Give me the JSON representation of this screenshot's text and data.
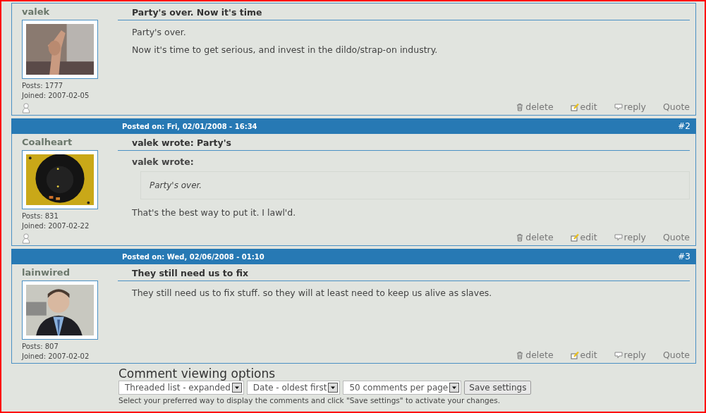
{
  "comments": [
    {
      "author": "valek",
      "avatar": {
        "kind": "picture"
      },
      "posts": "Posts: 1777",
      "joined": "Joined: 2007-02-05",
      "status_icon": true,
      "subject": "Party's over. Now it's time",
      "body": [
        "Party's over.",
        "Now it's time to get serious, and invest in the dildo/strap-on industry."
      ],
      "links": [
        {
          "kind": "delete",
          "label": "delete"
        },
        {
          "kind": "edit",
          "label": "edit"
        },
        {
          "kind": "reply",
          "label": "reply"
        },
        {
          "kind": "quote",
          "label": "Quote"
        }
      ]
    },
    {
      "header": {
        "posted": "Posted on: Fri, 02/01/2008 - 16:34",
        "number": "#2"
      },
      "author": "Coalheart",
      "avatar": {
        "kind": "picture"
      },
      "posts": "Posts: 831",
      "joined": "Joined: 2007-02-22",
      "status_icon": true,
      "subject": "valek wrote: Party's",
      "quote": {
        "label": "valek wrote:",
        "text": "Party's over."
      },
      "body": [
        "That's the best way to put it. I lawl'd."
      ],
      "links": [
        {
          "kind": "delete",
          "label": "delete"
        },
        {
          "kind": "edit",
          "label": "edit"
        },
        {
          "kind": "reply",
          "label": "reply"
        },
        {
          "kind": "quote",
          "label": "Quote"
        }
      ]
    },
    {
      "header": {
        "posted": "Posted on: Wed, 02/06/2008 - 01:10",
        "number": "#3"
      },
      "author": "lainwired",
      "avatar": {
        "kind": "picture"
      },
      "posts": "Posts: 807",
      "joined": "Joined: 2007-02-02",
      "status_icon": false,
      "subject": "They still need us to fix",
      "body": [
        "They still need us to fix stuff. so they will at least need to keep us alive as slaves."
      ],
      "links": [
        {
          "kind": "delete",
          "label": "delete"
        },
        {
          "kind": "edit",
          "label": "edit"
        },
        {
          "kind": "reply",
          "label": "reply"
        },
        {
          "kind": "quote",
          "label": "Quote"
        }
      ]
    }
  ],
  "viewing_options": {
    "title": "Comment viewing options",
    "selects": [
      "Threaded list - expanded",
      "Date - oldest first",
      "50 comments per page"
    ],
    "button": "Save settings",
    "help": "Select your preferred way to display the comments and click \"Save settings\" to activate your changes."
  }
}
